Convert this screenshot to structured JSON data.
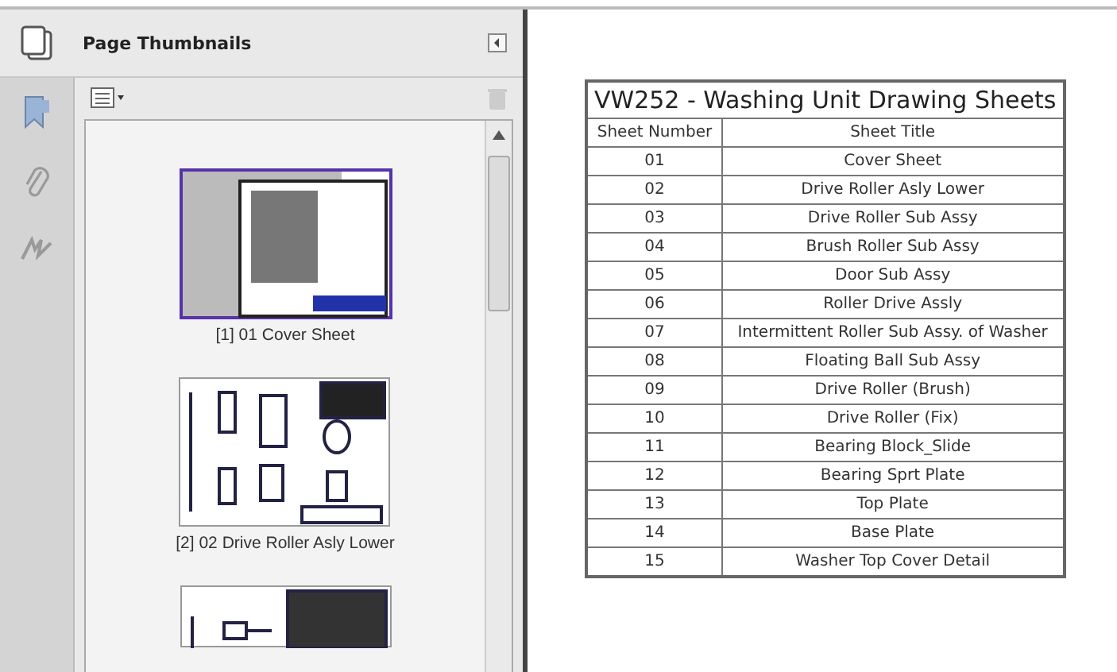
{
  "panel": {
    "title": "Page Thumbnails"
  },
  "thumbnails": [
    {
      "caption": "[1] 01 Cover Sheet",
      "selected": true,
      "kind": "cover"
    },
    {
      "caption": "[2] 02 Drive Roller Asly Lower",
      "selected": false,
      "kind": "parts"
    },
    {
      "selected": false,
      "kind": "detail"
    }
  ],
  "table": {
    "title": "VW252 - Washing Unit Drawing Sheets",
    "columns": [
      "Sheet Number",
      "Sheet Title"
    ],
    "rows": [
      [
        "01",
        "Cover Sheet"
      ],
      [
        "02",
        "Drive Roller Asly Lower"
      ],
      [
        "03",
        "Drive Roller Sub Assy"
      ],
      [
        "04",
        "Brush Roller Sub Assy"
      ],
      [
        "05",
        "Door Sub Assy"
      ],
      [
        "06",
        "Roller Drive Assly"
      ],
      [
        "07",
        "Intermittent Roller Sub Assy. of Washer"
      ],
      [
        "08",
        "Floating Ball Sub Assy"
      ],
      [
        "09",
        "Drive Roller (Brush)"
      ],
      [
        "10",
        "Drive Roller (Fix)"
      ],
      [
        "11",
        "Bearing Block_Slide"
      ],
      [
        "12",
        "Bearing Sprt Plate"
      ],
      [
        "13",
        "Top Plate"
      ],
      [
        "14",
        "Base Plate"
      ],
      [
        "15",
        "Washer Top Cover Detail"
      ]
    ]
  }
}
